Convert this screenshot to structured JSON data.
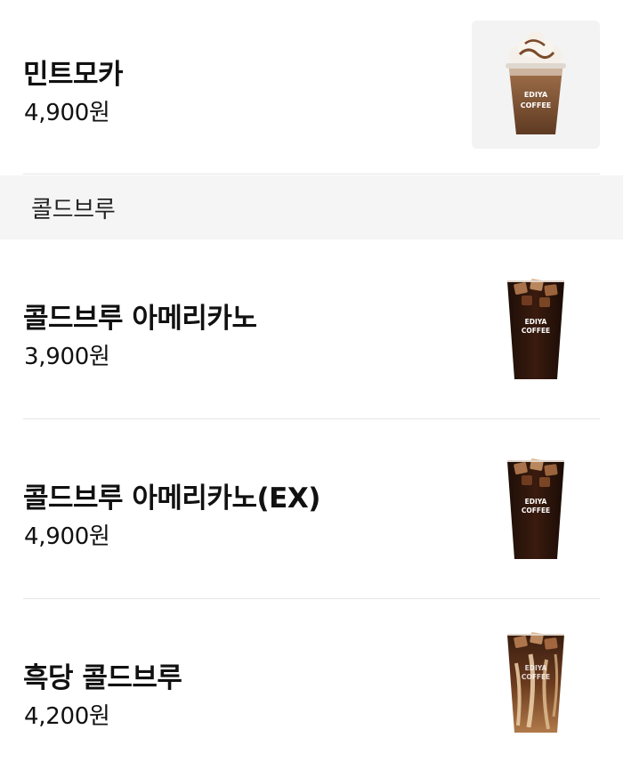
{
  "menu": {
    "items_top": [
      {
        "name": "민트모카",
        "price": "4,900원",
        "image": "mint-mocha-frappe-icon"
      }
    ],
    "section": {
      "title": "콜드브루",
      "items": [
        {
          "name": "콜드브루 아메리카노",
          "price": "3,900원",
          "image": "iced-americano-cup-icon"
        },
        {
          "name": "콜드브루 아메리카노(EX)",
          "price": "4,900원",
          "image": "iced-americano-cup-icon"
        },
        {
          "name": "흑당 콜드브루",
          "price": "4,200원",
          "image": "brown-sugar-cold-brew-cup-icon"
        }
      ]
    },
    "cup_brand_text": [
      "EDIYA",
      "COFFEE"
    ]
  },
  "colors": {
    "background": "#ffffff",
    "section_background": "#f5f5f5",
    "divider": "#e6e6e6",
    "thumb_background": "#f3f3f3"
  }
}
